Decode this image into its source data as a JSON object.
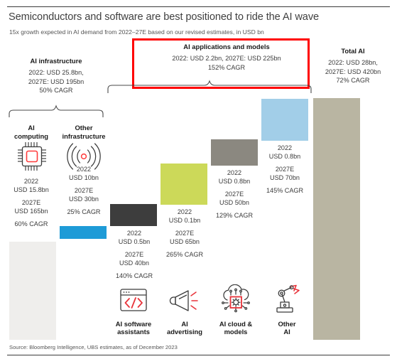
{
  "title": "Semiconductors and software are best positioned to ride the AI wave",
  "subtitle": "15x growth expected in AI demand from 2022–27E based on our revised estimates, in USD bn",
  "source": "Source: Bloomberg Intelligence, UBS estimates, as of December 2023",
  "groups": {
    "infrastructure": {
      "title": "AI infrastructure",
      "line1": "2022: USD 25.8bn,",
      "line2": "2027E: USD 195bn",
      "line3": "50% CAGR"
    },
    "applications": {
      "title": "AI applications and models",
      "line1": "2022: USD 2.2bn, 2027E: USD 225bn",
      "line2": "152% CAGR",
      "highlight_color": "#ff0000"
    },
    "total": {
      "title": "Total AI",
      "line1": "2022: USD 28bn,",
      "line2": "2027E: USD 420bn",
      "line3": "72% CAGR"
    }
  },
  "subheads": {
    "ai_computing": "AI\ncomputing",
    "ai_computing_l1": "AI",
    "ai_computing_l2": "computing",
    "other_infra_l1": "Other",
    "other_infra_l2": "infrastructure"
  },
  "categories": [
    {
      "key": "ai-computing",
      "label_l1": "AI",
      "label_l2": "computing",
      "icon": "microchip-icon",
      "y2022_label": "2022",
      "y2022_value": "USD 15.8bn",
      "y2027_label": "2027E",
      "y2027_value": "USD 165bn",
      "cagr": "60% CAGR",
      "bar_color": "#efeeec"
    },
    {
      "key": "other-infrastructure",
      "label_l1": "Other",
      "label_l2": "infrastructure",
      "icon": "wireless-signal-icon",
      "y2022_label": "2022",
      "y2022_value": "USD 10bn",
      "y2027_label": "2027E",
      "y2027_value": "USD 30bn",
      "cagr": "25% CAGR",
      "bar_color": "#1e9bd7"
    },
    {
      "key": "ai-software-assistants",
      "label_l1": "AI software",
      "label_l2": "assistants",
      "icon": "code-window-icon",
      "y2022_label": "2022",
      "y2022_value": "USD 0.5bn",
      "y2027_label": "2027E",
      "y2027_value": "USD 40bn",
      "cagr": "140% CAGR",
      "bar_color": "#3d3d3d"
    },
    {
      "key": "ai-advertising",
      "label_l1": "AI",
      "label_l2": "advertising",
      "icon": "megaphone-icon",
      "y2022_label": "2022",
      "y2022_value": "USD 0.1bn",
      "y2027_label": "2027E",
      "y2027_value": "USD 65bn",
      "cagr": "265% CAGR",
      "bar_color": "#ccd959"
    },
    {
      "key": "ai-cloud-and-models",
      "label_l1": "AI cloud &",
      "label_l2": "models",
      "icon": "cloud-gear-icon",
      "y2022_label": "2022",
      "y2022_value": "USD 0.8bn",
      "y2027_label": "2027E",
      "y2027_value": "USD 50bn",
      "cagr": "129% CAGR",
      "bar_color": "#8b8880"
    },
    {
      "key": "other-ai",
      "label_l1": "Other",
      "label_l2": "AI",
      "icon": "robot-arm-icon",
      "y2022_label": "2022",
      "y2022_value": "USD 0.8bn",
      "y2027_label": "2027E",
      "y2027_value": "USD 70bn",
      "cagr": "145% CAGR",
      "bar_color": "#a2cee8"
    },
    {
      "key": "total-ai",
      "label_l1": "",
      "label_l2": "",
      "icon": "",
      "y2022_label": "",
      "y2022_value": "",
      "y2027_label": "",
      "y2027_value": "",
      "cagr": "",
      "bar_color": "#b9b5a2"
    }
  ],
  "chart_data": {
    "type": "bar",
    "title": "Semiconductors and software are best positioned to ride the AI wave",
    "subtitle": "15x growth expected in AI demand from 2022–27E based on our revised estimates, in USD bn",
    "ylabel": "USD bn",
    "xlabel": "",
    "grid": false,
    "legend": "none",
    "note": "Waterfall-style stacked build from AI computing up to Total AI (2027E values)",
    "categories": [
      "AI computing",
      "Other infrastructure",
      "AI software assistants",
      "AI advertising",
      "AI cloud & models",
      "Other AI",
      "Total AI"
    ],
    "series": [
      {
        "name": "2022",
        "values": [
          15.8,
          10,
          0.5,
          0.1,
          0.8,
          0.8,
          28
        ]
      },
      {
        "name": "2027E",
        "values": [
          165,
          30,
          40,
          65,
          50,
          70,
          420
        ]
      }
    ],
    "cagr": [
      "60%",
      "25%",
      "140%",
      "265%",
      "129%",
      "145%",
      "72%"
    ],
    "ylim": [
      0,
      420
    ],
    "colors": [
      "#efeeec",
      "#1e9bd7",
      "#3d3d3d",
      "#ccd959",
      "#8b8880",
      "#a2cee8",
      "#b9b5a2"
    ]
  }
}
